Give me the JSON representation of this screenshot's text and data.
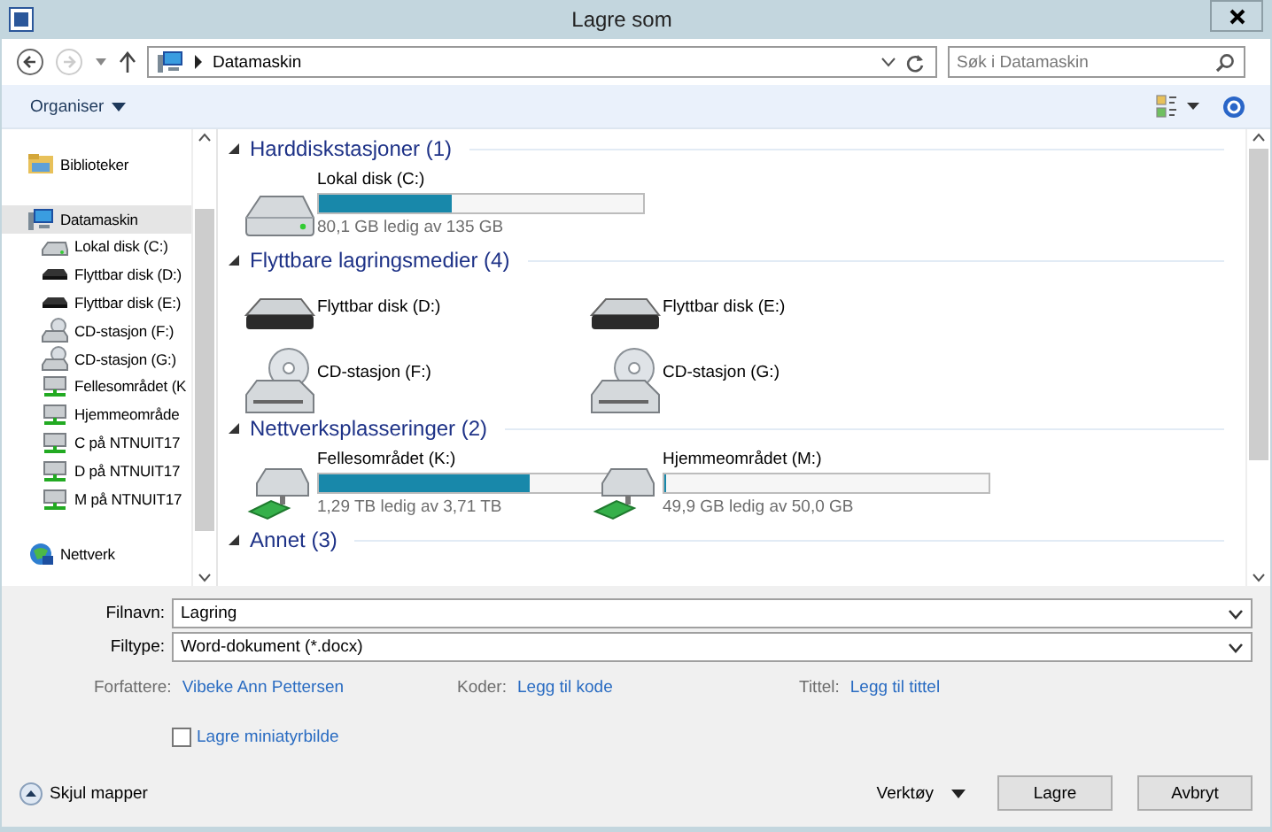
{
  "window": {
    "title": "Lagre som"
  },
  "nav": {
    "address": "Datamaskin",
    "search_placeholder": "Søk i Datamaskin"
  },
  "toolbar": {
    "organise": "Organiser"
  },
  "sidebar": {
    "items": [
      {
        "label": "Biblioteker",
        "kind": "library",
        "selected": false
      },
      {
        "label": "Datamaskin",
        "kind": "computer",
        "selected": true,
        "children": [
          {
            "label": "Lokal disk (C:)",
            "kind": "hdd",
            "selected": false
          },
          {
            "label": "Flyttbar disk (D:)",
            "kind": "removable",
            "selected": false
          },
          {
            "label": "Flyttbar disk (E:)",
            "kind": "removable",
            "selected": false
          },
          {
            "label": "CD-stasjon (F:)",
            "kind": "cd",
            "selected": false
          },
          {
            "label": "CD-stasjon (G:)",
            "kind": "cd",
            "selected": false
          },
          {
            "label": "Fellesområdet (K",
            "kind": "netdrive",
            "selected": false
          },
          {
            "label": "Hjemmeområde",
            "kind": "netdrive",
            "selected": false
          },
          {
            "label": "C på NTNUIT17",
            "kind": "netdrive",
            "selected": false
          },
          {
            "label": "D på NTNUIT17",
            "kind": "netdrive",
            "selected": false
          },
          {
            "label": "M på NTNUIT17",
            "kind": "netdrive",
            "selected": false
          }
        ]
      },
      {
        "label": "Nettverk",
        "kind": "network",
        "selected": false
      }
    ]
  },
  "groups": [
    {
      "title": "Harddiskstasjoner (1)",
      "items": [
        {
          "name": "Lokal disk (C:)",
          "kind": "hdd",
          "level": 0.41,
          "free": "80,1 GB ledig av 135 GB"
        }
      ]
    },
    {
      "title": "Flyttbare lagringsmedier (4)",
      "items": [
        {
          "name": "Flyttbar disk (D:)",
          "kind": "removable"
        },
        {
          "name": "Flyttbar disk (E:)",
          "kind": "removable"
        },
        {
          "name": "CD-stasjon (F:)",
          "kind": "cd"
        },
        {
          "name": "CD-stasjon (G:)",
          "kind": "cd"
        }
      ]
    },
    {
      "title": "Nettverksplasseringer (2)",
      "items": [
        {
          "name": "Fellesområdet (K:)",
          "kind": "netdrive",
          "level": 0.65,
          "free": "1,29 TB ledig av 3,71 TB"
        },
        {
          "name": "Hjemmeområdet (M:)",
          "kind": "netdrive",
          "level": 0.002,
          "free": "49,9 GB ledig av 50,0 GB"
        }
      ]
    },
    {
      "title": "Annet (3)"
    }
  ],
  "form": {
    "filename_label": "Filnavn:",
    "filename": "Lagring",
    "filetype_label": "Filtype:",
    "filetype": "Word-dokument (*.docx)",
    "meta": [
      {
        "label": "Forfattere:",
        "value": "Vibeke Ann Pettersen"
      },
      {
        "label": "Koder:",
        "value": "Legg til kode"
      },
      {
        "label": "Tittel:",
        "value": "Legg til tittel"
      }
    ],
    "thumbnail": {
      "label": "Lagre miniatyrbilde",
      "checked": false
    }
  },
  "footer": {
    "hide_folders": "Skjul mapper",
    "tools": "Verktøy",
    "buttons": [
      "Lagre",
      "Avbryt"
    ]
  }
}
